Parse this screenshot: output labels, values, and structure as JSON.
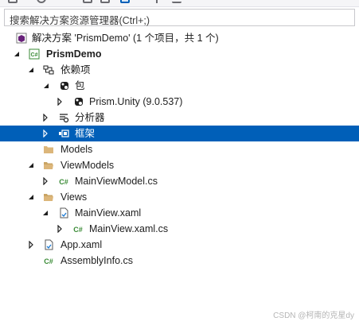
{
  "search": {
    "placeholder": "搜索解决方案资源管理器(Ctrl+;)"
  },
  "tree": {
    "solution": "解决方案 'PrismDemo' (1 个项目，共 1 个)",
    "project": "PrismDemo",
    "dependencies": "依赖项",
    "packages": "包",
    "prism_unity": "Prism.Unity (9.0.537)",
    "analyzers": "分析器",
    "frameworks": "框架",
    "models": "Models",
    "viewmodels": "ViewModels",
    "mainviewmodel_cs": "MainViewModel.cs",
    "views": "Views",
    "mainview_xaml": "MainView.xaml",
    "mainview_xaml_cs": "MainView.xaml.cs",
    "app_xaml": "App.xaml",
    "assemblyinfo_cs": "AssemblyInfo.cs"
  },
  "icons": {
    "csharp_text": "C#"
  },
  "colors": {
    "selection": "#005fb8",
    "folder": "#dcb67a",
    "csharp": "#388a34"
  },
  "watermark": "CSDN @柯南的克星dy"
}
